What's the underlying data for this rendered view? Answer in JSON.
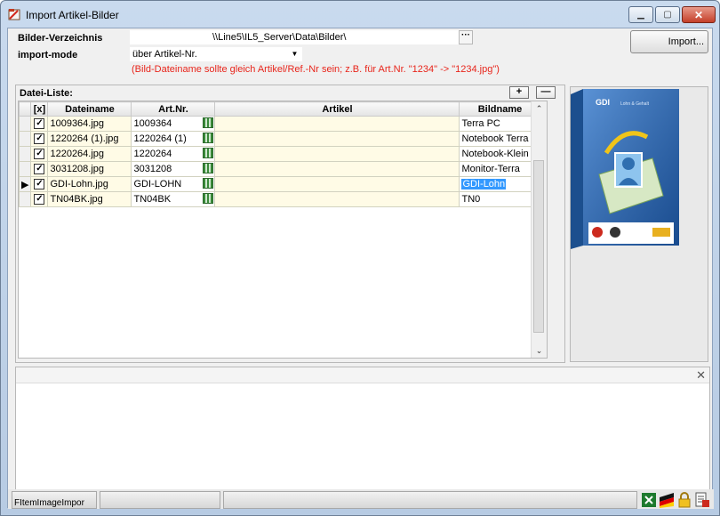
{
  "window": {
    "title": "Import Artikel-Bilder"
  },
  "form": {
    "dir_label": "Bilder-Verzeichnis",
    "dir_value": "\\\\Line5\\IL5_Server\\Data\\Bilder\\",
    "browse_label": "···",
    "mode_label": "import-mode",
    "mode_value": "über Artikel-Nr.",
    "hint": "(Bild-Dateiname sollte gleich Artikel/Ref.-Nr sein; z.B. für Art.Nr. \"1234\" -> \"1234.jpg\")",
    "import_button": "Import..."
  },
  "file_list": {
    "title": "Datei-Liste:",
    "add_label": "+",
    "remove_label": "—",
    "columns": [
      "[x]",
      "Dateiname",
      "Art.Nr.",
      "Artikel",
      "Bildname"
    ],
    "rows": [
      {
        "checked": true,
        "file": "1009364.jpg",
        "artnr": "1009364",
        "artikel": "",
        "bild": "Terra PC"
      },
      {
        "checked": true,
        "file": "1220264 (1).jpg",
        "artnr": "1220264 (1)",
        "artikel": "",
        "bild": "Notebook Terra"
      },
      {
        "checked": true,
        "file": "1220264.jpg",
        "artnr": "1220264",
        "artikel": "",
        "bild": "Notebook-Klein"
      },
      {
        "checked": true,
        "file": "3031208.jpg",
        "artnr": "3031208",
        "artikel": "",
        "bild": "Monitor-Terra"
      },
      {
        "checked": true,
        "file": "GDI-Lohn.jpg",
        "artnr": "GDI-LOHN",
        "artikel": "",
        "bild": "GDI-Lohn"
      },
      {
        "checked": true,
        "file": "TN04BK.jpg",
        "artnr": "TN04BK",
        "artikel": "",
        "bild": "TN0"
      }
    ],
    "current_row": 4
  },
  "preview": {
    "box_brand": "GDI",
    "box_title": "Lohn & Gehalt"
  },
  "status": {
    "panel1": "FItemImageImpor"
  },
  "colors": {
    "hint": "#e8251b",
    "selection": "#3399ff",
    "row_yellow": "#fffbe6"
  }
}
